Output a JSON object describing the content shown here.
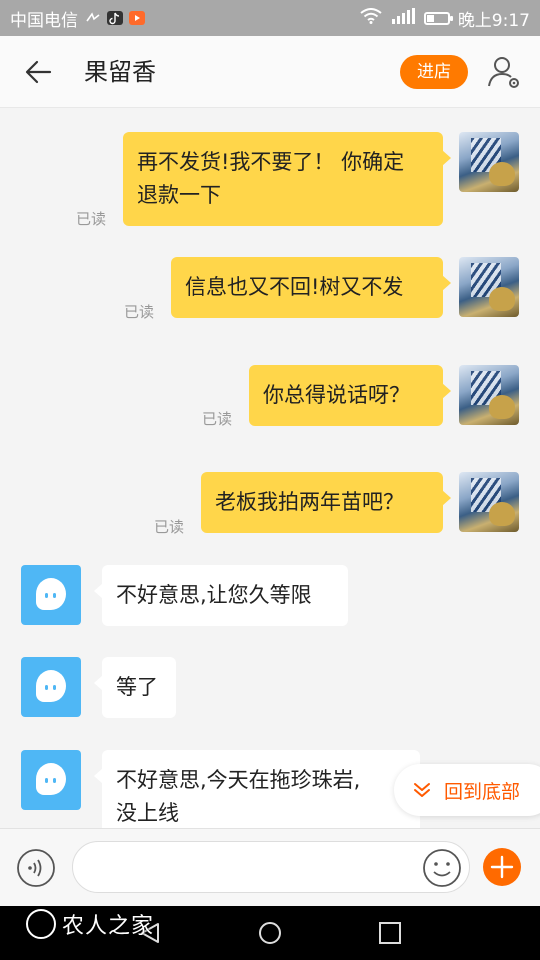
{
  "status_bar": {
    "carrier": "中国电信",
    "time": "晚上9:17",
    "battery_level": 0.35
  },
  "header": {
    "title": "果留香",
    "store_button": "进店"
  },
  "messages": [
    {
      "side": "out",
      "text_lines": [
        "再不发货!我不要了！ 你确定",
        "退款一下"
      ],
      "status": "已读"
    },
    {
      "side": "out",
      "text_lines": [
        "信息也又不回!树又不发"
      ],
      "status": "已读"
    },
    {
      "side": "out",
      "text_lines": [
        "你总得说话呀？"
      ],
      "status": "已读"
    },
    {
      "side": "out",
      "text_lines": [
        "老板我拍两年苗吧？"
      ],
      "status": "已读"
    },
    {
      "side": "in",
      "text_lines": [
        "不好意思,让您久等限"
      ]
    },
    {
      "side": "in",
      "text_lines": [
        "等了"
      ]
    },
    {
      "side": "in",
      "text_lines": [
        "不好意思,今天在拖珍珠岩,",
        "没上线"
      ]
    }
  ],
  "back_to_bottom": "回到底部",
  "input": {
    "placeholder": ""
  },
  "watermark": "农人之家",
  "colors": {
    "accent": "#ff7a00",
    "outgoing_bubble": "#ffd64a",
    "shop_avatar": "#4fb7f5",
    "link_orange": "#ff5a00"
  },
  "icons": [
    "back-arrow-icon",
    "profile-settings-icon",
    "voice-icon",
    "emoji-icon",
    "plus-icon",
    "chevron-down-icon",
    "wifi-icon",
    "signal-icon",
    "battery-icon"
  ]
}
